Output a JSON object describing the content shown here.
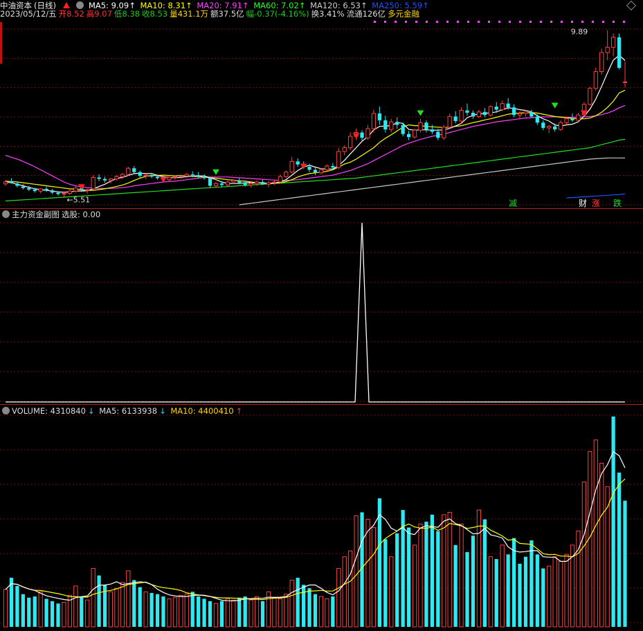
{
  "header": {
    "stock_name": "中油资本",
    "period": "(日线)",
    "ma_items": [
      {
        "label": "MA5: 9.09",
        "color": "#ffffff"
      },
      {
        "label": "MA10: 8.31",
        "color": "#ffff00"
      },
      {
        "label": "MA20: 7.91",
        "color": "#ff40ff"
      },
      {
        "label": "MA60: 7.02",
        "color": "#20ff20"
      },
      {
        "label": "MA120: 6.53",
        "color": "#cccccc"
      },
      {
        "label": "MA250: 5.59",
        "color": "#2050ff"
      }
    ],
    "quote": {
      "date": "2023/05/12/五",
      "open": "开8.52",
      "high": "高9.07",
      "low": "低8.38",
      "close": "收8.53",
      "volume": "量431.1万",
      "amount": "额37.5亿",
      "change": "幅-0.37(-4.16%)",
      "turnover": "换3.41%",
      "float": "流通126亿",
      "concept": "多元金融"
    }
  },
  "sub_header": {
    "title": "主力资金副图",
    "pick": "选股: 0.00"
  },
  "vol_header": {
    "volume": "VOLUME: 4310840",
    "ma5": "MA5: 6133938",
    "ma10": "MA10: 4400410"
  },
  "labels": {
    "high_label": "9.89",
    "low_label": "5.51",
    "tag_reduce": "减",
    "tag_fin": "财",
    "tag_up": "涨",
    "tag_down": "跌"
  },
  "colors": {
    "up": "#ff4040",
    "down": "#30e8f0",
    "bg": "#000000",
    "grid": "#7a1010"
  },
  "chart_data": {
    "type": "candlestick",
    "panels": [
      "price",
      "main_capital",
      "volume"
    ],
    "price_range": [
      5.3,
      10.1
    ],
    "candles": [
      [
        5.85,
        5.95,
        5.8,
        5.9
      ],
      [
        5.92,
        6.0,
        5.86,
        5.88
      ],
      [
        5.86,
        5.9,
        5.76,
        5.8
      ],
      [
        5.78,
        5.84,
        5.7,
        5.74
      ],
      [
        5.74,
        5.8,
        5.66,
        5.7
      ],
      [
        5.7,
        5.75,
        5.62,
        5.66
      ],
      [
        5.66,
        5.74,
        5.6,
        5.72
      ],
      [
        5.72,
        5.78,
        5.64,
        5.68
      ],
      [
        5.68,
        5.72,
        5.58,
        5.62
      ],
      [
        5.62,
        5.66,
        5.54,
        5.58
      ],
      [
        5.58,
        5.64,
        5.51,
        5.6
      ],
      [
        5.6,
        5.7,
        5.56,
        5.66
      ],
      [
        5.66,
        5.8,
        5.62,
        5.74
      ],
      [
        5.74,
        5.78,
        5.64,
        5.68
      ],
      [
        5.68,
        5.72,
        5.6,
        5.7
      ],
      [
        5.72,
        6.08,
        5.7,
        6.02
      ],
      [
        6.02,
        6.1,
        5.92,
        5.98
      ],
      [
        5.98,
        6.04,
        5.88,
        5.94
      ],
      [
        5.94,
        6.0,
        5.86,
        5.98
      ],
      [
        5.98,
        6.08,
        5.94,
        6.04
      ],
      [
        6.04,
        6.14,
        5.98,
        6.1
      ],
      [
        6.1,
        6.3,
        6.06,
        6.26
      ],
      [
        6.26,
        6.32,
        6.12,
        6.16
      ],
      [
        6.16,
        6.2,
        6.02,
        6.06
      ],
      [
        6.06,
        6.12,
        5.98,
        6.08
      ],
      [
        6.08,
        6.14,
        6.0,
        6.04
      ],
      [
        6.04,
        6.1,
        5.96,
        6.0
      ],
      [
        6.0,
        6.06,
        5.92,
        5.96
      ],
      [
        5.96,
        6.04,
        5.9,
        6.02
      ],
      [
        6.02,
        6.08,
        5.96,
        6.04
      ],
      [
        6.04,
        6.1,
        5.98,
        6.06
      ],
      [
        6.06,
        6.14,
        6.0,
        6.1
      ],
      [
        6.1,
        6.18,
        6.02,
        6.08
      ],
      [
        6.08,
        6.16,
        6.0,
        6.04
      ],
      [
        6.04,
        6.1,
        5.96,
        6.0
      ],
      [
        6.0,
        6.04,
        5.74,
        5.8
      ],
      [
        5.8,
        5.9,
        5.74,
        5.86
      ],
      [
        5.86,
        5.92,
        5.76,
        5.82
      ],
      [
        5.82,
        5.94,
        5.78,
        5.9
      ],
      [
        5.9,
        5.98,
        5.84,
        5.94
      ],
      [
        5.94,
        6.0,
        5.84,
        5.88
      ],
      [
        5.88,
        5.94,
        5.78,
        5.82
      ],
      [
        5.82,
        5.9,
        5.76,
        5.86
      ],
      [
        5.86,
        5.94,
        5.8,
        5.9
      ],
      [
        5.9,
        5.96,
        5.82,
        5.84
      ],
      [
        5.84,
        5.92,
        5.76,
        5.88
      ],
      [
        5.88,
        5.96,
        5.82,
        5.9
      ],
      [
        5.9,
        6.1,
        5.86,
        6.04
      ],
      [
        6.04,
        6.2,
        6.0,
        6.16
      ],
      [
        6.16,
        6.56,
        6.12,
        6.44
      ],
      [
        6.44,
        6.52,
        6.3,
        6.36
      ],
      [
        6.36,
        6.44,
        6.24,
        6.3
      ],
      [
        6.3,
        6.38,
        6.16,
        6.22
      ],
      [
        6.22,
        6.28,
        6.08,
        6.14
      ],
      [
        6.14,
        6.26,
        6.1,
        6.22
      ],
      [
        6.22,
        6.36,
        6.18,
        6.32
      ],
      [
        6.32,
        6.4,
        6.22,
        6.28
      ],
      [
        6.28,
        6.8,
        6.24,
        6.7
      ],
      [
        6.7,
        6.86,
        6.6,
        6.8
      ],
      [
        6.8,
        7.2,
        6.74,
        7.1
      ],
      [
        7.1,
        7.3,
        7.0,
        7.2
      ],
      [
        7.2,
        7.26,
        6.98,
        7.06
      ],
      [
        7.06,
        7.4,
        7.0,
        7.3
      ],
      [
        7.3,
        7.8,
        7.2,
        7.7
      ],
      [
        7.7,
        7.88,
        7.4,
        7.52
      ],
      [
        7.52,
        7.64,
        7.2,
        7.28
      ],
      [
        7.28,
        7.56,
        7.2,
        7.48
      ],
      [
        7.48,
        7.6,
        7.3,
        7.4
      ],
      [
        7.4,
        7.46,
        7.1,
        7.16
      ],
      [
        7.16,
        7.24,
        7.0,
        7.08
      ],
      [
        7.08,
        7.3,
        7.04,
        7.26
      ],
      [
        7.26,
        7.56,
        7.2,
        7.46
      ],
      [
        7.46,
        7.52,
        7.2,
        7.28
      ],
      [
        7.28,
        7.4,
        7.16,
        7.22
      ],
      [
        7.22,
        7.3,
        7.0,
        7.06
      ],
      [
        7.06,
        7.4,
        7.0,
        7.34
      ],
      [
        7.34,
        7.7,
        7.3,
        7.62
      ],
      [
        7.62,
        7.76,
        7.44,
        7.5
      ],
      [
        7.5,
        7.86,
        7.44,
        7.78
      ],
      [
        7.78,
        7.96,
        7.64,
        7.72
      ],
      [
        7.72,
        7.78,
        7.56,
        7.62
      ],
      [
        7.62,
        7.8,
        7.58,
        7.74
      ],
      [
        7.74,
        7.84,
        7.6,
        7.66
      ],
      [
        7.66,
        7.92,
        7.62,
        7.88
      ],
      [
        7.88,
        8.0,
        7.72,
        7.8
      ],
      [
        7.8,
        8.04,
        7.76,
        7.96
      ],
      [
        7.96,
        8.1,
        7.8,
        7.86
      ],
      [
        7.86,
        7.94,
        7.6,
        7.66
      ],
      [
        7.66,
        7.76,
        7.56,
        7.7
      ],
      [
        7.7,
        7.8,
        7.62,
        7.74
      ],
      [
        7.74,
        7.8,
        7.58,
        7.62
      ],
      [
        7.62,
        7.68,
        7.4,
        7.46
      ],
      [
        7.46,
        7.52,
        7.26,
        7.32
      ],
      [
        7.32,
        7.4,
        7.18,
        7.36
      ],
      [
        7.36,
        7.44,
        7.22,
        7.28
      ],
      [
        7.28,
        7.52,
        7.24,
        7.46
      ],
      [
        7.46,
        7.62,
        7.4,
        7.56
      ],
      [
        7.56,
        7.7,
        7.48,
        7.52
      ],
      [
        7.52,
        7.72,
        7.48,
        7.66
      ],
      [
        7.66,
        8.0,
        7.62,
        7.94
      ],
      [
        7.94,
        8.4,
        7.9,
        8.36
      ],
      [
        8.36,
        8.9,
        8.3,
        8.8
      ],
      [
        8.8,
        9.4,
        8.72,
        9.3
      ],
      [
        9.3,
        9.89,
        9.1,
        9.44
      ],
      [
        9.44,
        9.8,
        9.2,
        9.7
      ],
      [
        9.7,
        9.8,
        8.86,
        8.9
      ],
      [
        8.52,
        9.07,
        8.38,
        8.53
      ]
    ],
    "ma5": [
      5.9,
      5.88,
      5.84,
      5.8,
      5.76,
      5.72,
      5.7,
      5.68,
      5.66,
      5.64,
      5.63,
      5.64,
      5.66,
      5.66,
      5.67,
      5.72,
      5.78,
      5.84,
      5.92,
      5.99,
      6.02,
      6.07,
      6.12,
      6.13,
      6.12,
      6.12,
      6.07,
      6.04,
      6.02,
      6.01,
      6.02,
      6.04,
      6.06,
      6.06,
      6.06,
      6.01,
      5.96,
      5.9,
      5.86,
      5.86,
      5.86,
      5.88,
      5.88,
      5.88,
      5.87,
      5.86,
      5.87,
      5.9,
      5.96,
      6.08,
      6.2,
      6.29,
      6.34,
      6.29,
      6.25,
      6.24,
      6.24,
      6.33,
      6.47,
      6.64,
      6.8,
      6.97,
      7.09,
      7.27,
      7.36,
      7.37,
      7.38,
      7.46,
      7.44,
      7.28,
      7.26,
      7.27,
      7.27,
      7.26,
      7.26,
      7.27,
      7.31,
      7.37,
      7.44,
      7.59,
      7.65,
      7.69,
      7.7,
      7.72,
      7.74,
      7.8,
      7.85,
      7.83,
      7.8,
      7.78,
      7.74,
      7.64,
      7.56,
      7.5,
      7.4,
      7.37,
      7.4,
      7.42,
      7.48,
      7.63,
      7.81,
      8.08,
      8.41,
      8.77,
      9.1,
      9.23,
      9.09
    ],
    "ma10": [
      5.92,
      5.91,
      5.9,
      5.88,
      5.86,
      5.84,
      5.82,
      5.8,
      5.78,
      5.76,
      5.74,
      5.72,
      5.71,
      5.69,
      5.68,
      5.68,
      5.7,
      5.72,
      5.75,
      5.78,
      5.82,
      5.87,
      5.94,
      6.0,
      6.05,
      6.07,
      6.07,
      6.08,
      6.07,
      6.06,
      6.07,
      6.06,
      6.05,
      6.04,
      6.03,
      6.01,
      6.0,
      5.98,
      5.96,
      5.95,
      5.93,
      5.92,
      5.9,
      5.88,
      5.87,
      5.86,
      5.87,
      5.88,
      5.91,
      5.96,
      6.03,
      6.08,
      6.12,
      6.14,
      6.16,
      6.18,
      6.22,
      6.29,
      6.37,
      6.42,
      6.5,
      6.6,
      6.7,
      6.8,
      6.94,
      7.05,
      7.14,
      7.24,
      7.34,
      7.4,
      7.38,
      7.38,
      7.36,
      7.35,
      7.34,
      7.33,
      7.34,
      7.36,
      7.38,
      7.42,
      7.46,
      7.49,
      7.53,
      7.56,
      7.6,
      7.64,
      7.68,
      7.7,
      7.71,
      7.72,
      7.72,
      7.71,
      7.68,
      7.65,
      7.62,
      7.6,
      7.59,
      7.57,
      7.56,
      7.56,
      7.58,
      7.64,
      7.73,
      7.86,
      8.02,
      8.24,
      8.31
    ],
    "ma20": [
      6.6,
      6.55,
      6.5,
      6.44,
      6.37,
      6.3,
      6.22,
      6.14,
      6.06,
      5.98,
      5.9,
      5.84,
      5.8,
      5.77,
      5.75,
      5.74,
      5.73,
      5.73,
      5.73,
      5.74,
      5.75,
      5.77,
      5.8,
      5.82,
      5.84,
      5.86,
      5.88,
      5.9,
      5.91,
      5.92,
      5.94,
      5.96,
      5.98,
      6.0,
      6.02,
      6.03,
      6.03,
      6.03,
      6.03,
      6.02,
      6.01,
      6.0,
      5.99,
      5.98,
      5.97,
      5.96,
      5.95,
      5.94,
      5.94,
      5.95,
      5.96,
      5.98,
      6.0,
      6.02,
      6.04,
      6.06,
      6.08,
      6.12,
      6.16,
      6.2,
      6.26,
      6.32,
      6.38,
      6.46,
      6.54,
      6.62,
      6.7,
      6.78,
      6.86,
      6.92,
      6.97,
      7.02,
      7.06,
      7.1,
      7.13,
      7.16,
      7.2,
      7.24,
      7.28,
      7.32,
      7.36,
      7.39,
      7.42,
      7.45,
      7.48,
      7.5,
      7.52,
      7.54,
      7.56,
      7.58,
      7.59,
      7.6,
      7.61,
      7.61,
      7.61,
      7.61,
      7.6,
      7.6,
      7.6,
      7.61,
      7.62,
      7.64,
      7.67,
      7.71,
      7.77,
      7.85,
      7.91
    ],
    "ma60": [
      5.4,
      5.41,
      5.42,
      5.43,
      5.44,
      5.45,
      5.46,
      5.47,
      5.48,
      5.49,
      5.5,
      5.51,
      5.52,
      5.53,
      5.54,
      5.55,
      5.56,
      5.57,
      5.58,
      5.59,
      5.6,
      5.61,
      5.62,
      5.63,
      5.64,
      5.65,
      5.66,
      5.67,
      5.68,
      5.69,
      5.7,
      5.71,
      5.72,
      5.73,
      5.74,
      5.75,
      5.76,
      5.77,
      5.78,
      5.79,
      5.8,
      5.81,
      5.82,
      5.83,
      5.84,
      5.85,
      5.86,
      5.87,
      5.88,
      5.89,
      5.9,
      5.91,
      5.92,
      5.93,
      5.94,
      5.95,
      5.96,
      5.97,
      5.98,
      5.99,
      6.0,
      6.02,
      6.04,
      6.06,
      6.08,
      6.1,
      6.12,
      6.14,
      6.16,
      6.18,
      6.2,
      6.22,
      6.24,
      6.26,
      6.28,
      6.3,
      6.32,
      6.34,
      6.36,
      6.38,
      6.4,
      6.42,
      6.44,
      6.46,
      6.48,
      6.5,
      6.52,
      6.54,
      6.56,
      6.58,
      6.6,
      6.62,
      6.64,
      6.66,
      6.68,
      6.7,
      6.72,
      6.74,
      6.76,
      6.78,
      6.8,
      6.84,
      6.88,
      6.92,
      6.96,
      7.0,
      7.02
    ],
    "ma120_start": 40,
    "ma120": [
      5.3,
      5.32,
      5.34,
      5.36,
      5.38,
      5.4,
      5.42,
      5.44,
      5.46,
      5.48,
      5.5,
      5.52,
      5.54,
      5.56,
      5.58,
      5.6,
      5.62,
      5.64,
      5.66,
      5.68,
      5.7,
      5.72,
      5.74,
      5.76,
      5.78,
      5.8,
      5.82,
      5.84,
      5.86,
      5.88,
      5.9,
      5.92,
      5.94,
      5.96,
      5.98,
      6.0,
      6.02,
      6.04,
      6.06,
      6.08,
      6.1,
      6.12,
      6.14,
      6.16,
      6.18,
      6.2,
      6.22,
      6.24,
      6.26,
      6.28,
      6.3,
      6.32,
      6.34,
      6.36,
      6.38,
      6.4,
      6.42,
      6.44,
      6.46,
      6.48,
      6.5,
      6.51,
      6.52,
      6.53,
      6.53,
      6.53,
      6.53
    ],
    "ma250_start": 96,
    "ma250": [
      5.48,
      5.49,
      5.5,
      5.51,
      5.52,
      5.53,
      5.54,
      5.55,
      5.56,
      5.57,
      5.59
    ],
    "main_capital": {
      "spike_index": 61,
      "spike_value": 1.0
    },
    "volume": [
      32,
      42,
      35,
      28,
      25,
      26,
      30,
      24,
      22,
      20,
      21,
      27,
      35,
      26,
      23,
      50,
      44,
      36,
      30,
      33,
      38,
      48,
      40,
      34,
      30,
      29,
      28,
      26,
      24,
      25,
      27,
      28,
      30,
      26,
      24,
      22,
      20,
      22,
      24,
      23,
      25,
      26,
      23,
      26,
      22,
      30,
      25,
      24,
      28,
      40,
      42,
      36,
      33,
      28,
      26,
      24,
      26,
      50,
      60,
      65,
      95,
      98,
      92,
      85,
      110,
      75,
      60,
      80,
      100,
      85,
      70,
      88,
      90,
      96,
      82,
      96,
      98,
      70,
      88,
      64,
      78,
      100,
      92,
      60,
      58,
      70,
      62,
      76,
      54,
      60,
      74,
      62,
      50,
      52,
      60,
      56,
      62,
      70,
      82,
      124,
      150,
      160,
      140,
      120,
      180,
      132,
      108
    ],
    "volume_up": [
      1,
      0,
      0,
      0,
      0,
      0,
      1,
      0,
      0,
      0,
      1,
      1,
      1,
      0,
      1,
      1,
      0,
      0,
      1,
      1,
      1,
      1,
      0,
      0,
      1,
      0,
      0,
      0,
      1,
      1,
      1,
      1,
      0,
      0,
      0,
      0,
      1,
      0,
      1,
      1,
      0,
      0,
      1,
      1,
      0,
      1,
      1,
      1,
      1,
      1,
      0,
      0,
      0,
      0,
      1,
      1,
      0,
      1,
      1,
      1,
      1,
      0,
      1,
      1,
      0,
      0,
      1,
      0,
      0,
      0,
      1,
      1,
      0,
      0,
      0,
      1,
      1,
      0,
      1,
      0,
      0,
      1,
      0,
      1,
      0,
      1,
      0,
      0,
      0,
      0,
      0,
      0,
      0,
      1,
      1,
      1,
      1,
      1,
      1,
      1,
      1,
      1,
      1,
      1,
      0,
      0,
      0
    ],
    "vol_ma5_label": "MA5",
    "vol_ma10_label": "MA10"
  }
}
